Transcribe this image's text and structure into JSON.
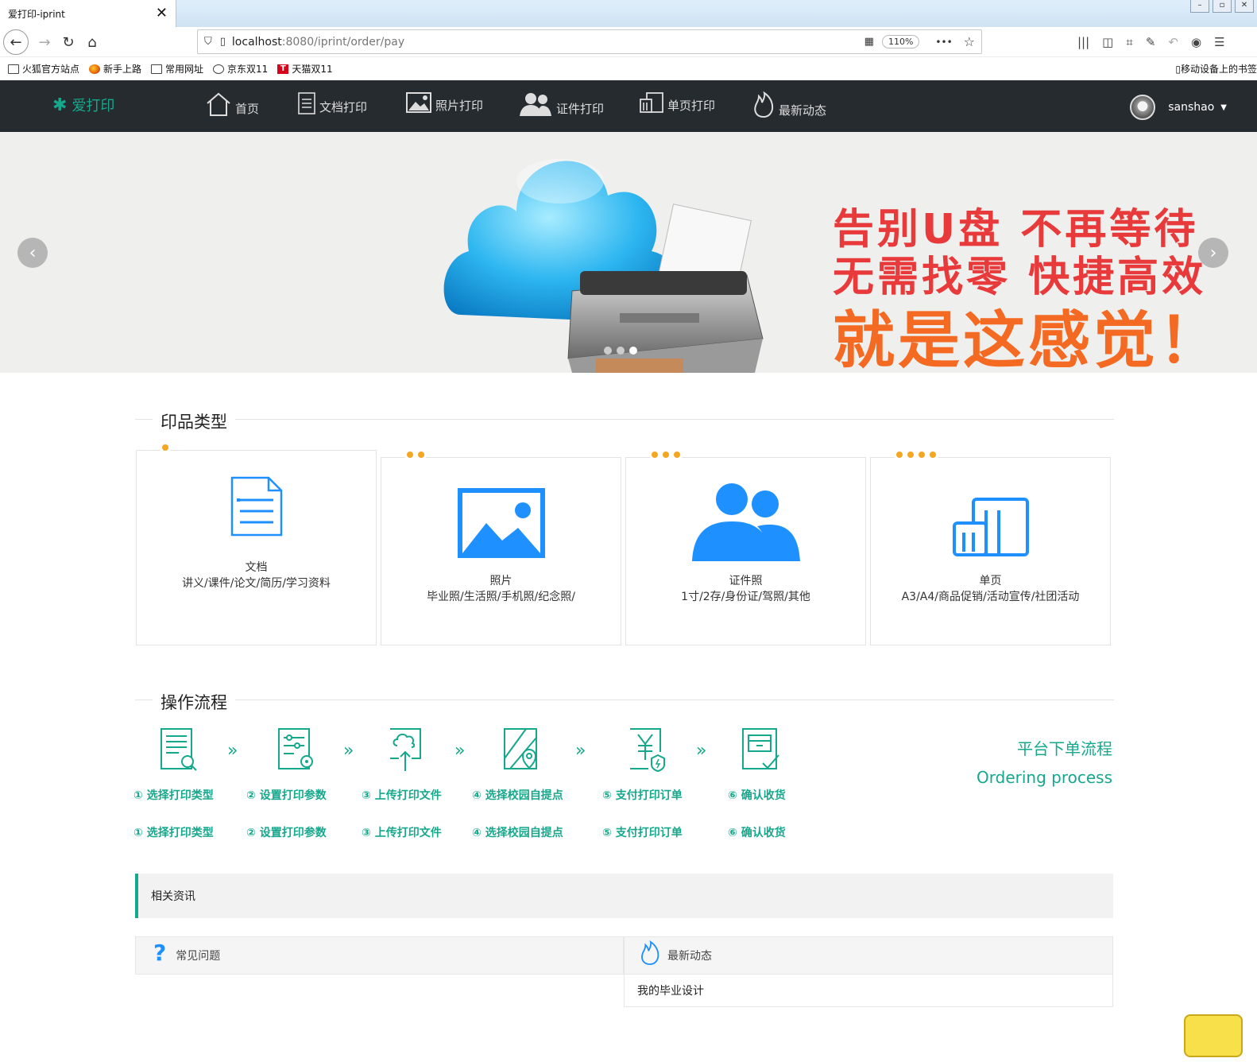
{
  "browser": {
    "tab_title": "爱打印-iprint",
    "tab_close": "✕",
    "url_host": "localhost",
    "url_rest": ":8080/iprint/order/pay",
    "zoom": "110%",
    "more": "•••",
    "bookmarks": [
      "火狐官方站点",
      "新手上路",
      "常用网址",
      "京东双11",
      "天猫双11"
    ],
    "mobile_bookmarks": "移动设备上的书签"
  },
  "site": {
    "logo_text": "爱打印",
    "menu": [
      "首页",
      "文档打印",
      "照片打印",
      "证件打印",
      "单页打印",
      "最新动态"
    ],
    "username": "sanshao"
  },
  "banner": {
    "line1": "告别U盘  不再等待",
    "line2": "无需找零  快捷高效",
    "line3": "就是这感觉！",
    "accent_red": "#e83a3a",
    "accent_orange": "#f46a22"
  },
  "print_types": {
    "title": "印品类型",
    "cards": [
      {
        "name": "文档",
        "desc": "讲义/课件/论文/简历/学习资料",
        "icon": "document-icon",
        "dots": 1
      },
      {
        "name": "照片",
        "desc": "毕业照/生活照/手机照/纪念照/",
        "icon": "photo-icon",
        "dots": 2
      },
      {
        "name": "证件照",
        "desc": "1寸/2存/身份证/驾照/其他",
        "icon": "people-icon",
        "dots": 3
      },
      {
        "name": "单页",
        "desc": "A3/A4/商品促销/活动宣传/社团活动",
        "icon": "pages-icon",
        "dots": 4
      }
    ]
  },
  "process": {
    "title": "操作流程",
    "chevron": "»",
    "steps": [
      "① 选择打印类型",
      "② 设置打印参数",
      "③ 上传打印文件",
      "④ 选择校园自提点",
      "⑤ 支付打印订单",
      "⑥ 确认收货"
    ],
    "side_title": "平台下单流程",
    "side_sub": "Ordering process"
  },
  "news": {
    "header": "相关资讯",
    "faq_label": "常见问题",
    "latest_label": "最新动态",
    "items": [
      "我的毕业设计"
    ]
  },
  "colors": {
    "brand": "#15a88c",
    "icon_blue": "#1e90ff",
    "dot_orange": "#f5a623",
    "header_bg": "#262b30"
  }
}
